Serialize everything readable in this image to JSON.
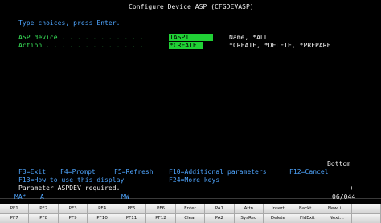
{
  "screen": {
    "title": "Configure Device ASP (CFGDEVASP)",
    "instructions": "Type choices, press Enter.",
    "fields": [
      {
        "label": "ASP device . . . . . . . . . . .",
        "value": "IASP1",
        "hint": "Name, *ALL"
      },
      {
        "label": "Action . . . . . . . . . . . . .",
        "value": "*CREATE",
        "hint": "*CREATE, *DELETE, *PREPARE"
      }
    ],
    "bottom_indicator": "Bottom",
    "plus_indicator": "+",
    "function_keys_line1": [
      {
        "label": "F3=Exit"
      },
      {
        "label": "F4=Prompt"
      },
      {
        "label": "F5=Refresh"
      },
      {
        "label": "F10=Additional parameters"
      },
      {
        "label": "F12=Cancel"
      }
    ],
    "function_keys_line2": [
      {
        "label": "F13=How to use this display"
      },
      {
        "label": "F24=More keys"
      }
    ],
    "message": "Parameter ASPDEV required."
  },
  "status_bar": {
    "session": "MA*",
    "mode": "A",
    "indicator": "MW",
    "cursor": "06/044"
  },
  "keypad": {
    "row1": [
      "PF1",
      "PF2",
      "PF3",
      "PF4",
      "PF5",
      "PF6",
      "Enter",
      "PA1",
      "Attn",
      "Insert",
      "Backt...",
      "NewLi..."
    ],
    "row2": [
      "PF7",
      "PF8",
      "PF9",
      "PF10",
      "PF11",
      "PF12",
      "Clear",
      "PA2",
      "SysReq",
      "Delete",
      "FldExit",
      "Next..."
    ]
  },
  "colors": {
    "background": "#000000",
    "text_white": "#f2f2f2",
    "text_blue": "#4fa6ff",
    "text_green": "#39e85a",
    "input_field": "#20d035"
  }
}
